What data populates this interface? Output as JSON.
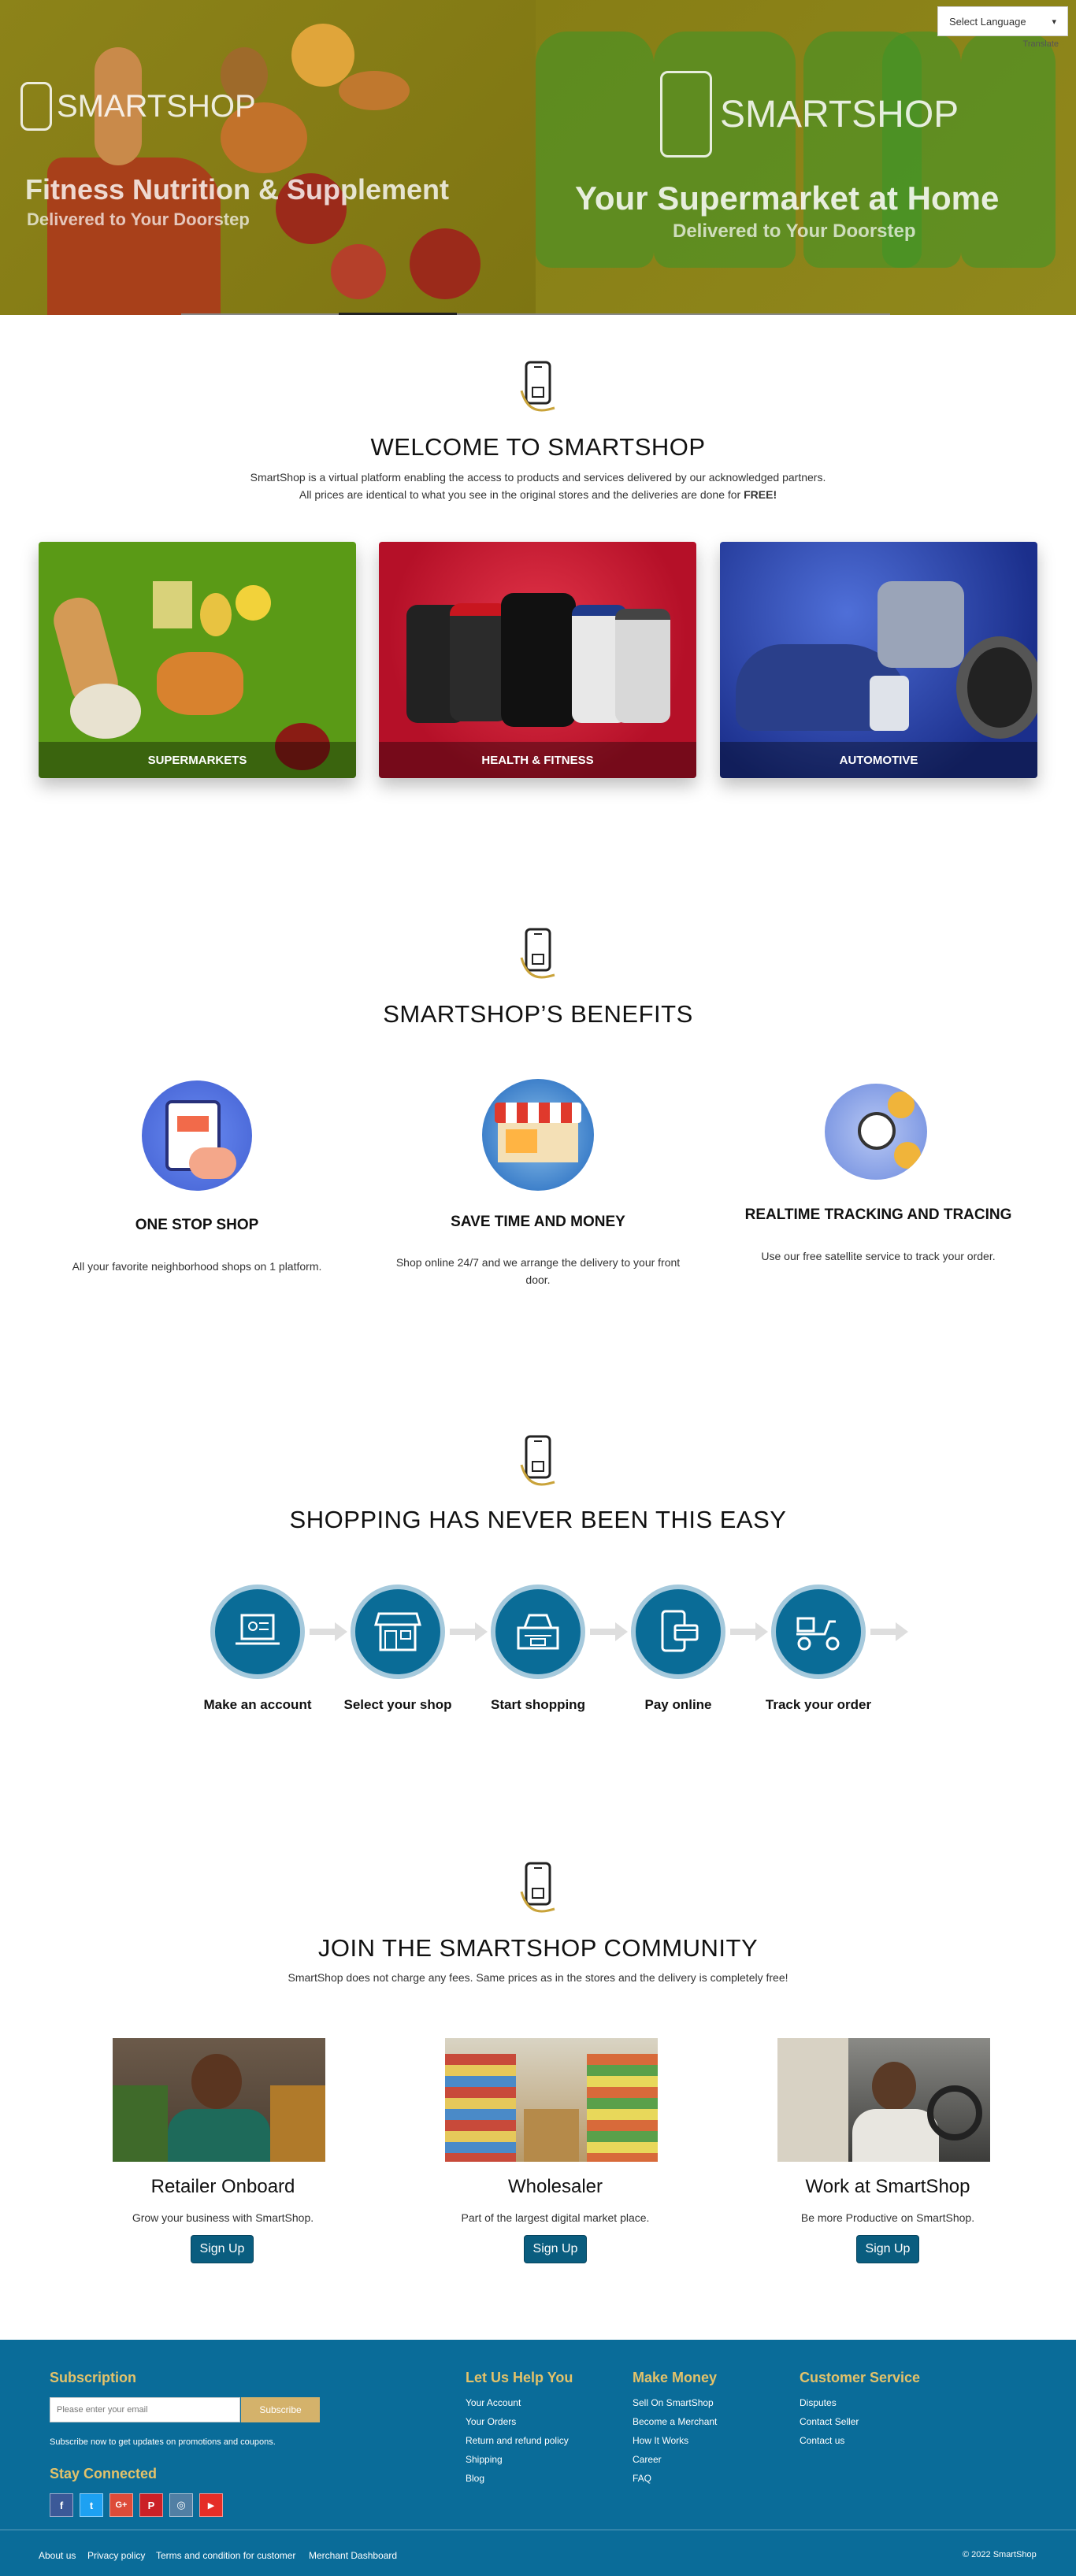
{
  "language": {
    "placeholder": "Select Language",
    "translate_label": "Translate"
  },
  "hero": {
    "left": {
      "brand": "SMARTSHOP",
      "title": "Fitness Nutrition & Supplement",
      "subtitle": "Delivered to Your Doorstep"
    },
    "right": {
      "brand": "SMARTSHOP",
      "title": "Your Supermarket at Home",
      "subtitle": "Delivered to Your Doorstep"
    }
  },
  "welcome": {
    "title": "WELCOME TO SMARTSHOP",
    "line1": "SmartShop is a virtual platform enabling the access to products and services delivered by our acknowledged partners.",
    "line2_prefix": "All prices are identical to what you see in the original stores and the deliveries are done for ",
    "line2_bold": "FREE!"
  },
  "categories": [
    {
      "label": "SUPERMARKETS",
      "color": "#5a9a16"
    },
    {
      "label": "HEALTH & FITNESS",
      "color": "#c0162f"
    },
    {
      "label": "AUTOMOTIVE",
      "color": "#1e3d9c"
    }
  ],
  "benefits": {
    "title": "SMARTSHOP’S BENEFITS",
    "items": [
      {
        "title": "ONE STOP SHOP",
        "text": "All your favorite neighborhood shops on 1 platform."
      },
      {
        "title": "SAVE TIME AND MONEY",
        "text": "Shop online 24/7 and we arrange the delivery to your front door."
      },
      {
        "title": "REALTIME TRACKING AND TRACING",
        "text": "Use our free satellite service to track your order."
      }
    ]
  },
  "steps": {
    "title": "SHOPPING HAS NEVER BEEN THIS EASY",
    "items": [
      {
        "label": "Make an account",
        "icon": "laptop-account-icon"
      },
      {
        "label": "Select your shop",
        "icon": "shop-icon"
      },
      {
        "label": "Start shopping",
        "icon": "cart-icon"
      },
      {
        "label": "Pay online",
        "icon": "phone-pay-icon"
      },
      {
        "label": "Track your order",
        "icon": "scooter-icon"
      }
    ]
  },
  "community": {
    "title": "JOIN THE SMARTSHOP COMMUNITY",
    "text": "SmartShop does not charge any fees. Same prices as in the stores and the delivery is completely free!",
    "items": [
      {
        "title": "Retailer Onboard",
        "text": "Grow your business with SmartShop.",
        "button": "Sign Up"
      },
      {
        "title": "Wholesaler",
        "text": "Part of the largest digital market place.",
        "button": "Sign Up"
      },
      {
        "title": "Work at SmartShop",
        "text": "Be more Productive on SmartShop.",
        "button": "Sign Up"
      }
    ]
  },
  "footer": {
    "subscription": {
      "title": "Subscription",
      "placeholder": "Please enter your email",
      "button": "Subscribe",
      "note": "Subscribe now to get updates on promotions and coupons."
    },
    "stay_connected": "Stay Connected",
    "social": [
      {
        "glyph": "f",
        "name": "facebook-icon",
        "color": "#3b5998"
      },
      {
        "glyph": "t",
        "name": "twitter-icon",
        "color": "#1da1f2"
      },
      {
        "glyph": "G+",
        "name": "google-plus-icon",
        "color": "#dd4b39"
      },
      {
        "glyph": "P",
        "name": "pinterest-icon",
        "color": "#cb2027"
      },
      {
        "glyph": "◎",
        "name": "instagram-icon",
        "color": "#517fa4"
      },
      {
        "glyph": "▶",
        "name": "youtube-icon",
        "color": "#e52d27"
      }
    ],
    "columns": [
      {
        "title": "Let Us Help You",
        "links": [
          "Your Account",
          "Your Orders",
          "Return and refund policy",
          "Shipping",
          "Blog"
        ]
      },
      {
        "title": "Make Money",
        "links": [
          "Sell On SmartShop",
          "Become a Merchant",
          "How It Works",
          "Career",
          "FAQ"
        ]
      },
      {
        "title": "Customer Service",
        "links": [
          "Disputes",
          "Contact Seller",
          "Contact us"
        ]
      }
    ],
    "bottom_links": [
      "About us",
      "Privacy policy",
      "Terms and condition for customer",
      "Merchant Dashboard"
    ],
    "copyright": "© 2022 SmartShop"
  }
}
